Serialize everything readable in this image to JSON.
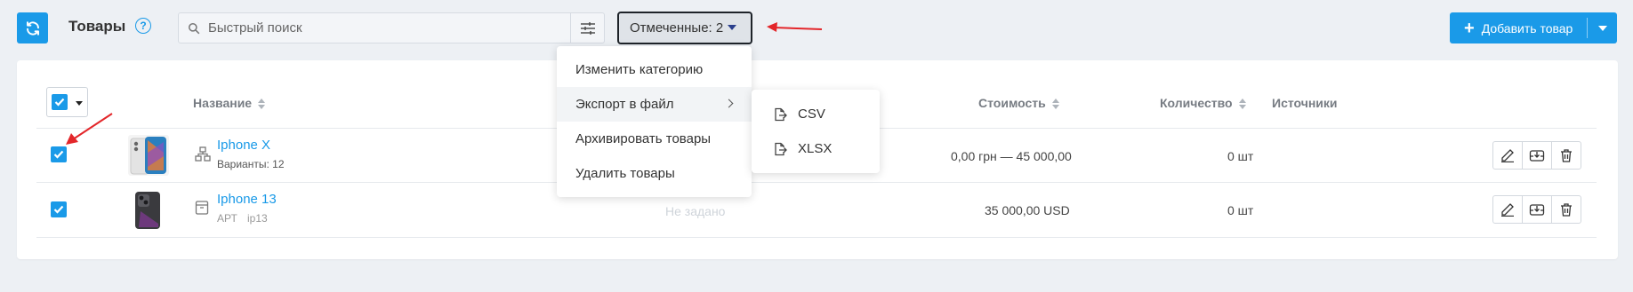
{
  "header": {
    "title": "Товары",
    "help_symbol": "?",
    "search_placeholder": "Быстрый поиск",
    "marked_label": "Отмеченные: 2",
    "add_label": "Добавить товар",
    "add_plus": "+"
  },
  "table": {
    "columns": {
      "name": "Название",
      "cost": "Стоимость",
      "quantity": "Количество",
      "sources": "Источники"
    },
    "rows": [
      {
        "name": "Iphone X",
        "sub": "Варианты: 12",
        "price": "0,00 грн — 45 000,00",
        "qty": "0 шт",
        "checked": true
      },
      {
        "name": "Iphone 13",
        "sub_code": "АРТ",
        "sub_sku": "ip13",
        "price": "35 000,00 USD",
        "qty": "0 шт",
        "checked": true
      }
    ],
    "partial_hidden_text": "Не задано"
  },
  "menu": {
    "items": [
      "Изменить категорию",
      "Экспорт в файл",
      "Архивировать товары",
      "Удалить товары"
    ],
    "export_sub": [
      "CSV",
      "XLSX"
    ]
  },
  "colors": {
    "accent": "#1a9ae8",
    "annotation": "#e3262a"
  }
}
